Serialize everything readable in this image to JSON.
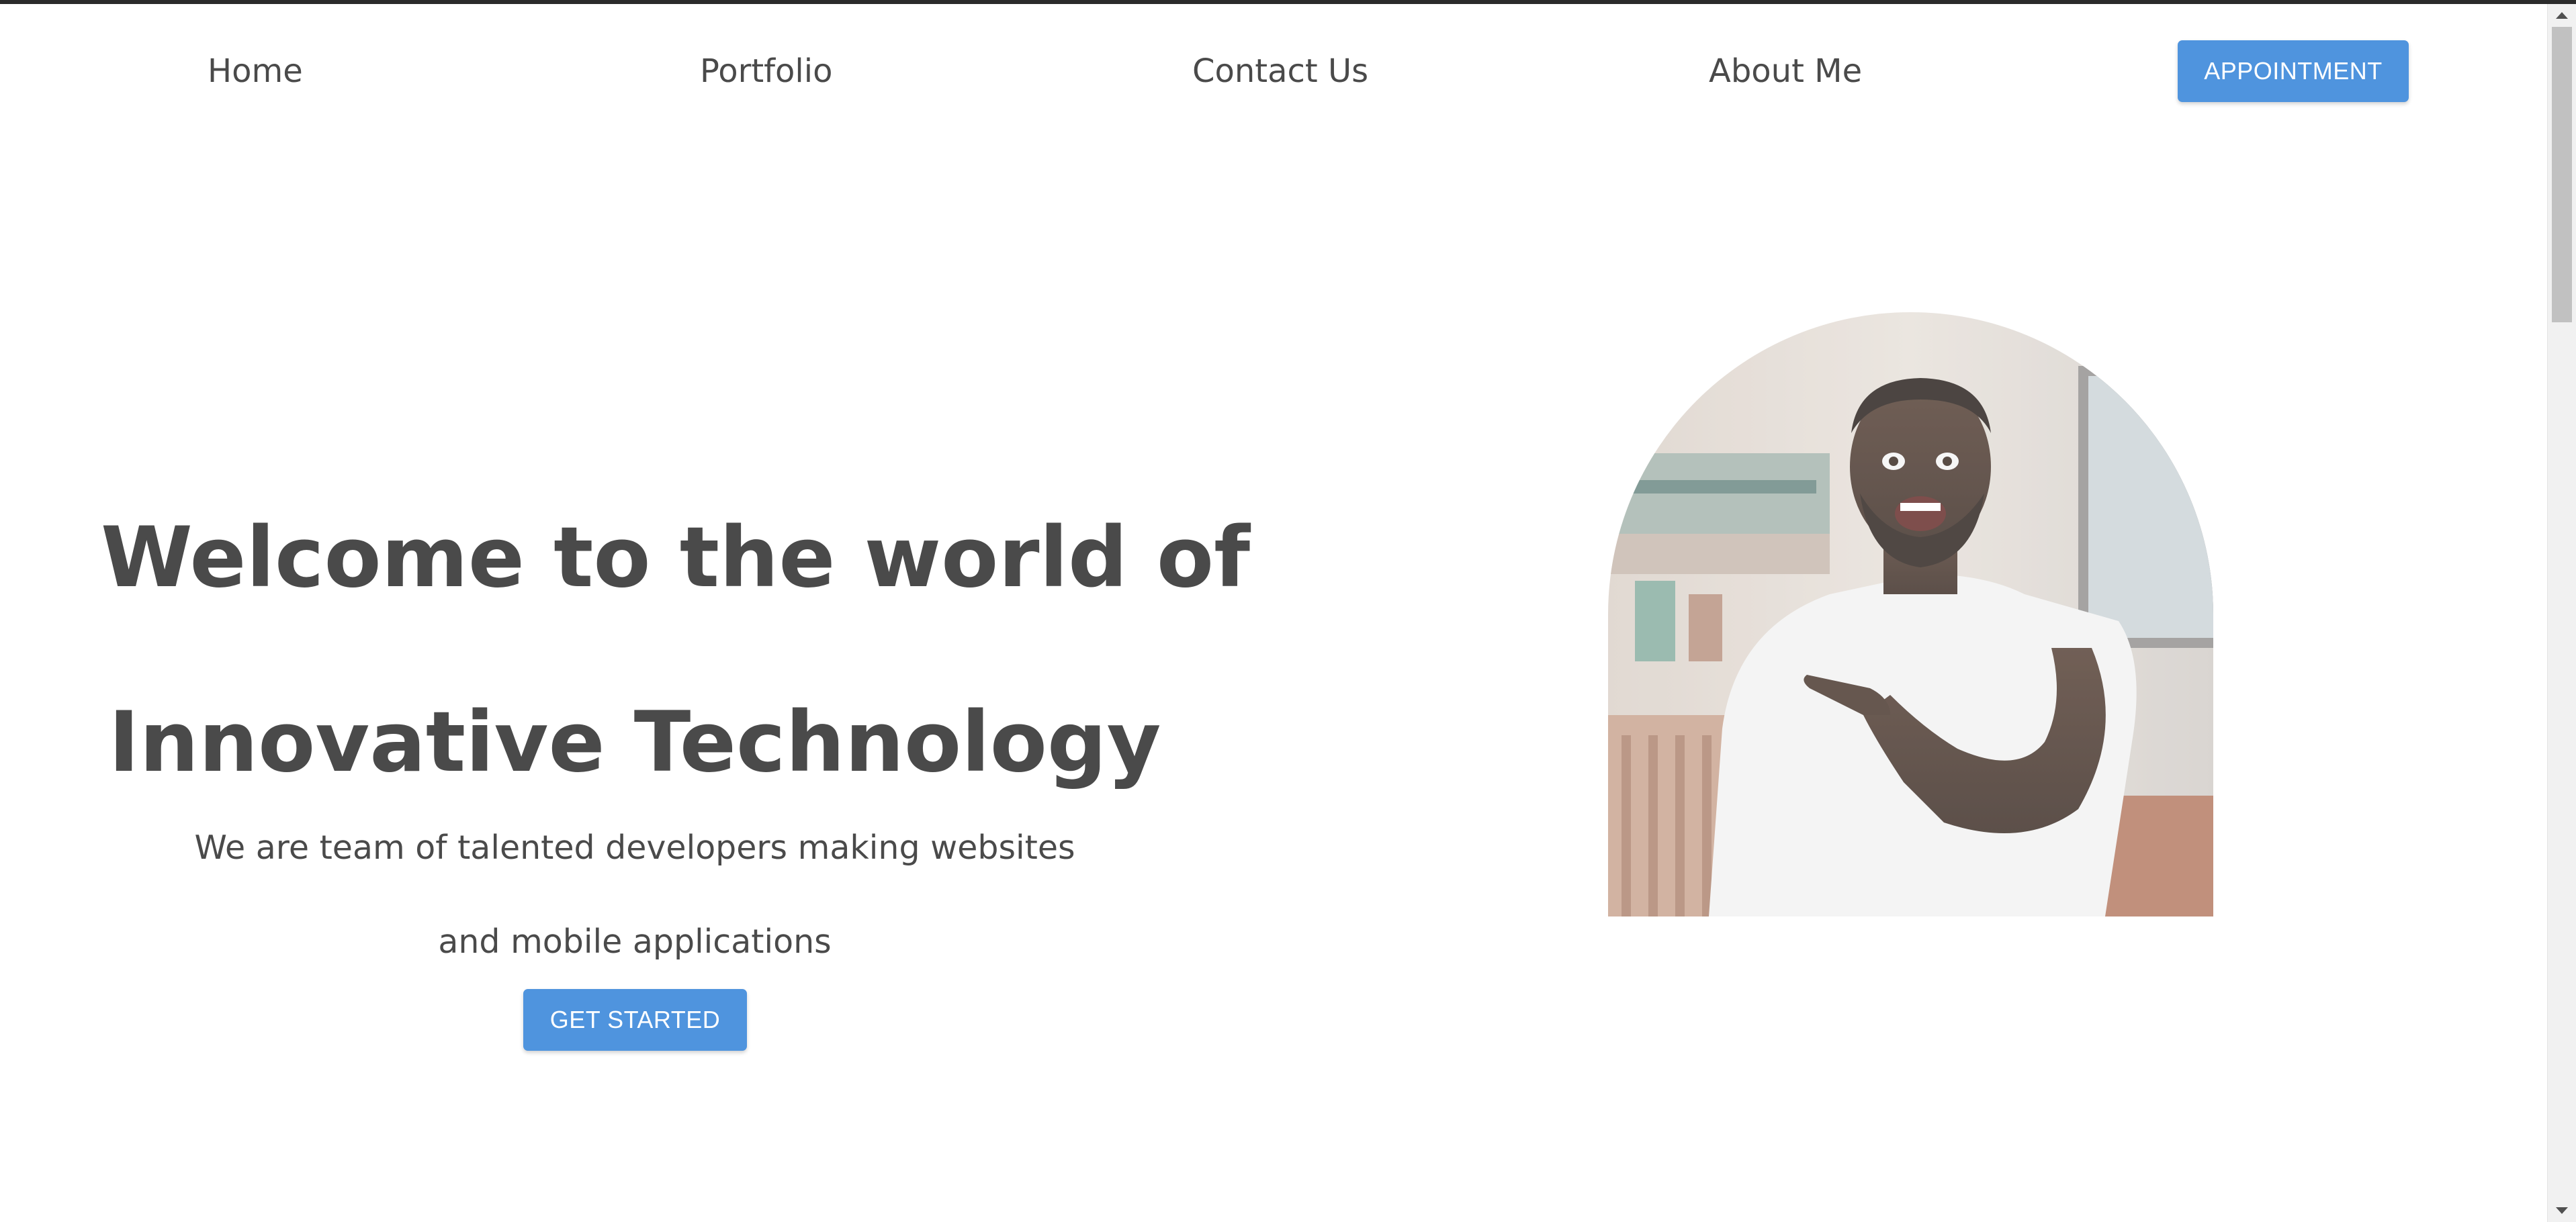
{
  "nav": {
    "items": [
      {
        "label": "Home"
      },
      {
        "label": "Portfolio"
      },
      {
        "label": "Contact Us"
      },
      {
        "label": "About Me"
      }
    ],
    "cta_label": "APPOINTMENT"
  },
  "hero": {
    "title_line_1": "Welcome to the world of",
    "title_line_2": "Innovative Technology",
    "subtitle_line_1": "We are team of talented developers making websites",
    "subtitle_line_2": "and mobile applications",
    "cta_label": "GET STARTED",
    "image": "smiling man in white t-shirt pointing"
  },
  "colors": {
    "accent": "#4f94de",
    "text": "#4a4a4a",
    "background": "#ffffff"
  }
}
